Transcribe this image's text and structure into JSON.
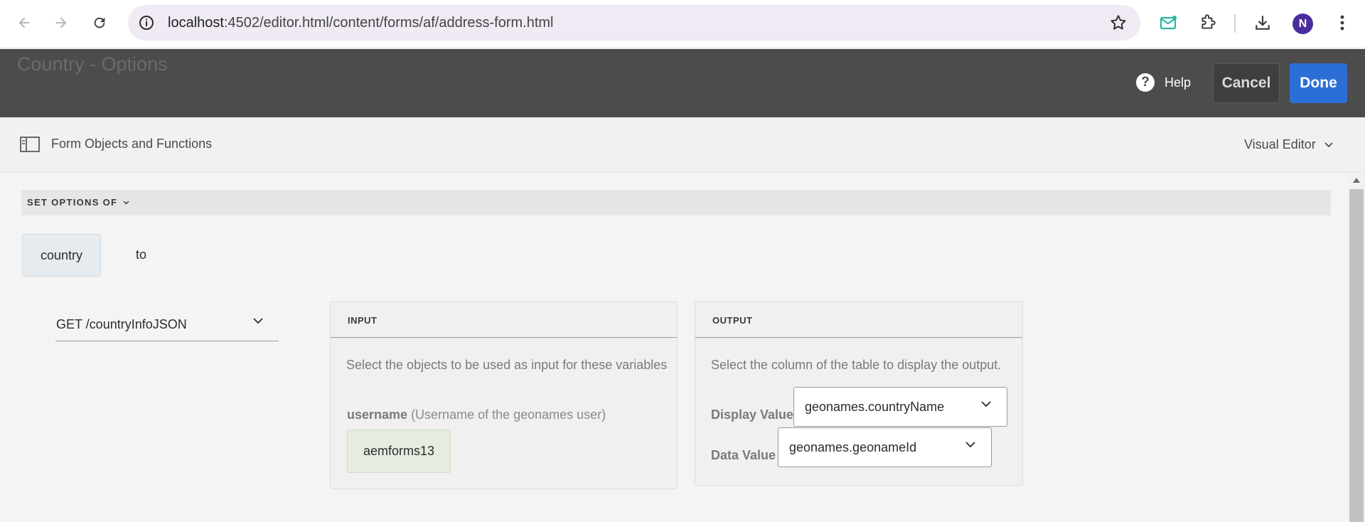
{
  "browser": {
    "url_host": "localhost",
    "url_path": ":4502/editor.html/content/forms/af/address-form.html",
    "avatar_letter": "N"
  },
  "header": {
    "title": "Country - Options",
    "help_label": "Help",
    "cancel_label": "Cancel",
    "done_label": "Done"
  },
  "toolbar": {
    "objects_label": "Form Objects and Functions",
    "mode_label": "Visual Editor"
  },
  "rule": {
    "set_options_label": "SET OPTIONS OF",
    "target_field": "country",
    "to_label": "to",
    "service": "GET /countryInfoJSON"
  },
  "input_panel": {
    "title": "INPUT",
    "description": "Select the objects to be used as input for these variables",
    "param_name": "username",
    "param_desc": "(Username of the geonames user)",
    "param_value": "aemforms13"
  },
  "output_panel": {
    "title": "OUTPUT",
    "description": "Select the column of the table to display the output.",
    "display_label": "Display Value",
    "display_value": "geonames.countryName",
    "data_label": "Data Value",
    "data_value": "geonames.geonameId"
  },
  "colors": {
    "header_bg": "#4c4c4c",
    "done_bg": "#2b6fd6",
    "avatar_bg": "#4b2c9d"
  }
}
